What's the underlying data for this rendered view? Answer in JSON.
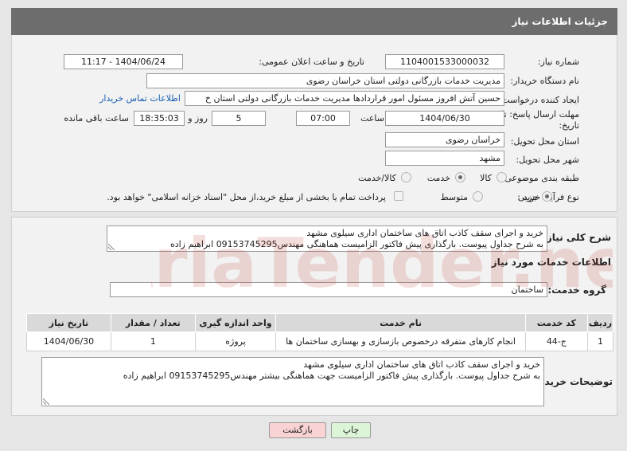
{
  "header": {
    "title": "جزئیات اطلاعات نیاز"
  },
  "fields": {
    "need_number": {
      "label": "شماره نیاز:",
      "value": "1104001533000032"
    },
    "announce_datetime": {
      "label": "تاریخ و ساعت اعلان عمومی:",
      "value": "1404/06/24 - 11:17"
    },
    "buyer_org": {
      "label": "نام دستگاه خریدار:",
      "value": "مدیریت خدمات بازرگانی دولتی استان خراسان رضوی"
    },
    "requester": {
      "label": "ایجاد کننده درخواست:",
      "value": "حسین آتش افروز مسئول امور قراردادها مدیریت خدمات بازرگانی دولتی استان خ",
      "contact_link": "اطلاعات تماس خریدار"
    },
    "deadline": {
      "label_line1": "مهلت ارسال پاسخ: تا",
      "label_line2": "تاریخ:",
      "date": "1404/06/30",
      "time_label": "ساعت",
      "time": "07:00",
      "days": "5",
      "days_label": "روز و",
      "remaining": "18:35:03",
      "remaining_label": "ساعت باقی مانده"
    },
    "province": {
      "label": "استان محل تحویل:",
      "value": "خراسان رضوی"
    },
    "city": {
      "label": "شهر محل تحویل:",
      "value": "مشهد"
    },
    "category": {
      "label": "طبقه بندی موضوعی:",
      "options": [
        "کالا",
        "خدمت",
        "کالا/خدمت"
      ],
      "selected": "خدمت"
    },
    "purchase_type": {
      "label": "نوع فرآیند خرید :",
      "options": [
        "جزیی",
        "متوسط"
      ],
      "selected": "جزیی",
      "treasury_note": "پرداخت تمام یا بخشی از مبلغ خرید،از محل \"اسناد خزانه اسلامی\" خواهد بود."
    }
  },
  "summary": {
    "label": "شرح کلی نیاز:",
    "line1": "خرید و اجرای سقف کاذب اتاق های ساختمان اداری سیلوی مشهد",
    "line2": "به شرح جداول پیوست. بارگذاری پیش فاکتور الزامیست هماهنگی مهندس09153745295 ابراهیم زاده"
  },
  "services_section": {
    "title": "اطلاعات خدمات مورد نیاز",
    "group_label": "گروه خدمت:",
    "group_value": "ساختمان",
    "columns": [
      "ردیف",
      "کد خدمت",
      "نام خدمت",
      "واحد اندازه گیری",
      "تعداد / مقدار",
      "تاریخ نیاز"
    ],
    "rows": [
      [
        "1",
        "ج-44",
        "انجام کارهای متفرقه درخصوص بازسازی و بهسازی ساختمان ها",
        "پروژه",
        "1",
        "1404/06/30"
      ]
    ]
  },
  "buyer_notes": {
    "label": "توضیحات خریدار:",
    "line1": "خرید و اجرای سقف کاذب اتاق های ساختمان اداری سیلوی مشهد",
    "line2": "به شرح جداول پیوست. بارگذاری پیش فاکتور الزامیست جهت هماهنگی بیشتر مهندس09153745295 ابراهیم زاده"
  },
  "buttons": {
    "print": "چاپ",
    "back": "بازگشت"
  },
  "watermark": "AriaTender.net",
  "colors": {
    "header_bg": "#6d6d6d",
    "link": "#1a5fb4",
    "back_button_bg": "#f9d3d3",
    "print_button_bg": "#dcf5d6",
    "watermark": "#c0392b"
  }
}
